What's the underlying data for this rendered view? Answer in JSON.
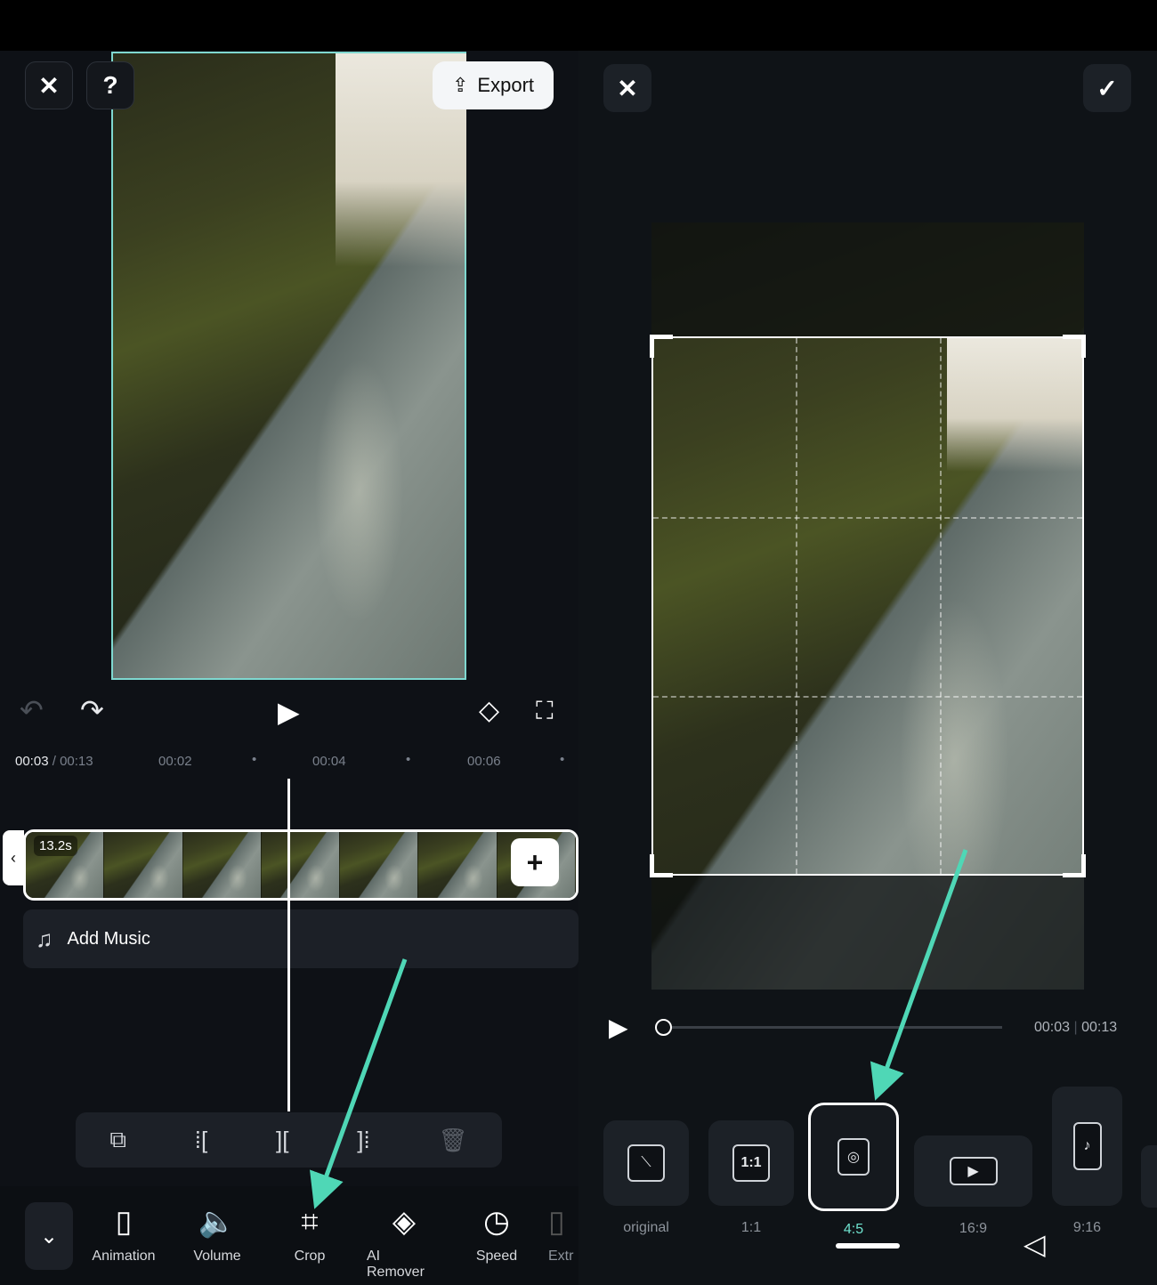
{
  "editor": {
    "close_icon": "close-icon",
    "help_label": "?",
    "export_label": "Export",
    "current_time": "00:03",
    "separator": "/",
    "total_time": "00:13",
    "ruler": [
      "00:02",
      "00:04",
      "00:06"
    ],
    "clip_duration": "13.2s",
    "add_music_label": "Add Music",
    "toolbar": [
      "Animation",
      "Volume",
      "Crop",
      "AI Remover",
      "Speed",
      "Extr"
    ]
  },
  "crop": {
    "current_time": "00:03",
    "total_time": "00:13",
    "ratios": [
      "original",
      "1:1",
      "4:5",
      "16:9",
      "9:16"
    ],
    "selected_ratio": "4:5",
    "ratio_inner_labels": [
      "1:1"
    ]
  },
  "colors": {
    "accent": "#5fd8c0",
    "selected_ratio": "#6fe3cf",
    "arrow": "#4fd7b6"
  }
}
